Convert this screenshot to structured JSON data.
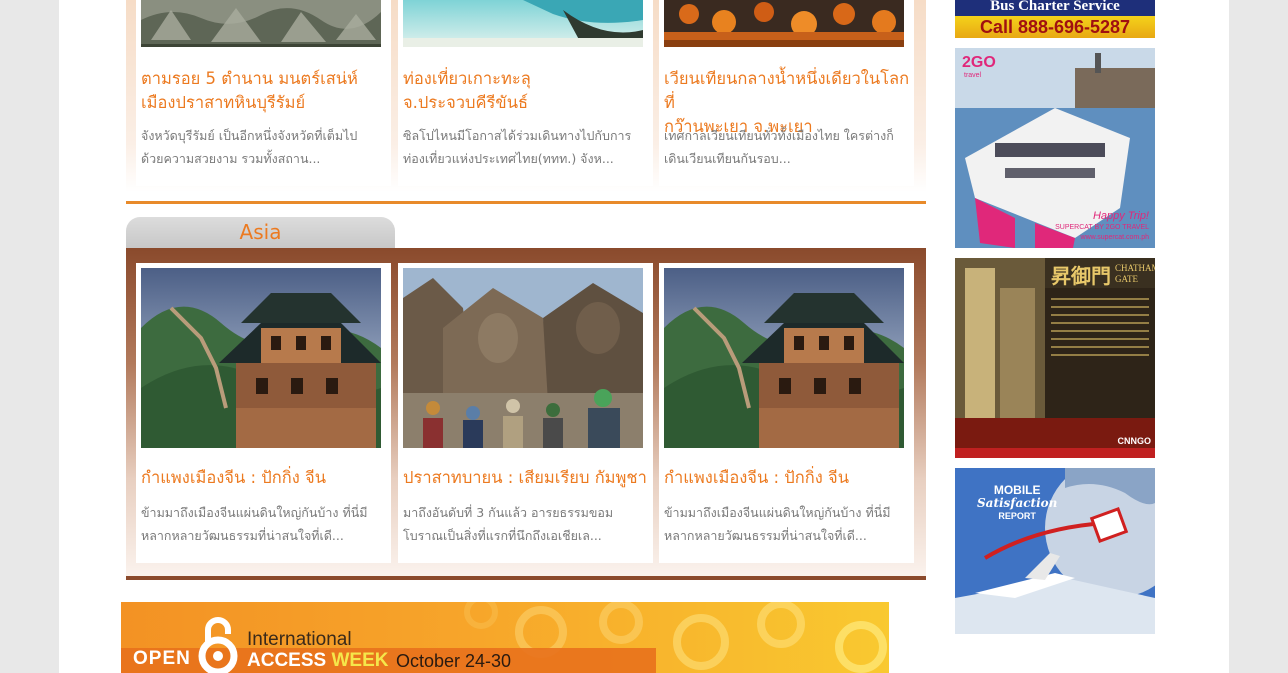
{
  "top_articles": [
    {
      "title_line1": "ตามรอย 5 ตำนาน มนตร์เสน่ห์",
      "title_line2": "เมืองปราสาทหินบุรีรัมย์",
      "desc": "จังหวัดบุรีรัมย์ เป็นอีกหนึ่งจังหวัดที่เต็มไปด้วยความสวยงาม รวมทั้งสถาน..."
    },
    {
      "title_line1": "ท่องเที่ยวเกาะทะลุ",
      "title_line2": "จ.ประจวบคีรีขันธ์",
      "desc": "ซิลโปไหนมีโอกาสได้ร่วมเดินทางไปกับการท่องเที่ยวแห่งประเทศไทย(ททท.) จังห..."
    },
    {
      "title_line1": "เวียนเทียนกลางน้ำหนึ่งเดียวในโลกที่",
      "title_line2": "กว๊านพะเยา จ.พะเยา",
      "desc": "เทศกาลเวียนเทียนทั่วทั้งเมืองไทย ใครต่างก็เดินเวียนเทียนกันรอบ..."
    }
  ],
  "asia": {
    "tab_label": "Asia",
    "articles": [
      {
        "title": "กำแพงเมืองจีน : ปักกิ่ง จีน",
        "desc": "ข้ามมาถึงเมืองจีนแผ่นดินใหญ่กันบ้าง ที่นี่มีหลากหลายวัฒนธรรมที่น่าสนใจที่เดี..."
      },
      {
        "title": "ปราสาทบายน : เสียมเรียบ กัมพูชา",
        "desc": "มาถึงอันดับที่ 3 กันแล้ว อารยธรรมขอมโบราณเป็นสิ่งที่แรกที่นึกถึงเอเชียเล..."
      },
      {
        "title": "กำแพงเมืองจีน : ปักกิ่ง จีน",
        "desc": "ข้ามมาถึงเมืองจีนแผ่นดินใหญ่กันบ้าง ที่นี่มีหลากหลายวัฒนธรรมที่น่าสนใจที่เดี..."
      }
    ]
  },
  "banner": {
    "open": "OPEN",
    "international": "International",
    "access": "ACCESS",
    "week": "WEEK",
    "dates": "October 24-30"
  },
  "sidebar_ads": {
    "bus": {
      "line1": "Bus Charter Service",
      "line2": "Call 888-696-5287"
    },
    "ferry": {
      "brand": "2GO",
      "brand_sub": "travel",
      "tagline": "Happy Trip!",
      "credit": "SUPERCAT BY 2GO TRAVEL",
      "url": "www.supercat.com.ph"
    },
    "hotel": {
      "name_cn": "昇御門",
      "name_en1": "CHATHAM",
      "name_en2": "GATE",
      "badge": "CNNGO"
    },
    "mobile": {
      "line1": "MOBILE",
      "line2": "Satisfaction",
      "line3": "REPORT"
    }
  },
  "colors": {
    "accent_orange": "#ec7a20",
    "section_brown": "#8b4a2c",
    "desc_gray": "#7a7a7a"
  }
}
